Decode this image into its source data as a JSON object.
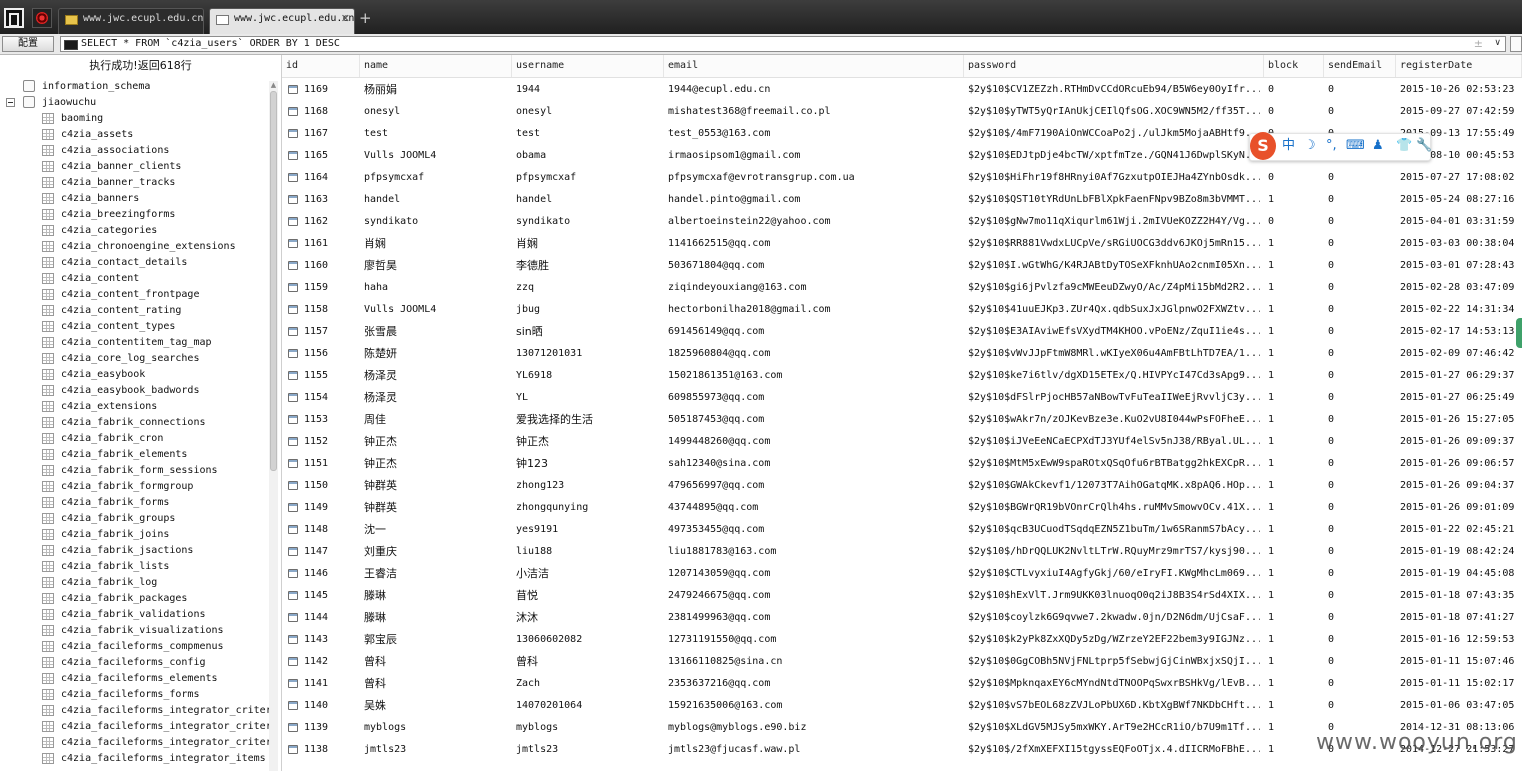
{
  "tabs": [
    {
      "label": "www.jwc.ecupl.edu.cn",
      "active": false
    },
    {
      "label": "www.jwc.ecupl.edu.cn",
      "active": true
    }
  ],
  "toolbar": {
    "config_label": "配置",
    "sql": "SELECT * FROM `c4zia_users` ORDER BY 1 DESC",
    "extra": "±",
    "dropdown": "∨"
  },
  "status": "执行成功!返回618行",
  "tree": {
    "databases": [
      {
        "name": "information_schema",
        "expanded": false
      },
      {
        "name": "jiaowuchu",
        "expanded": true
      }
    ],
    "tables": [
      "baoming",
      "c4zia_assets",
      "c4zia_associations",
      "c4zia_banner_clients",
      "c4zia_banner_tracks",
      "c4zia_banners",
      "c4zia_breezingforms",
      "c4zia_categories",
      "c4zia_chronoengine_extensions",
      "c4zia_contact_details",
      "c4zia_content",
      "c4zia_content_frontpage",
      "c4zia_content_rating",
      "c4zia_content_types",
      "c4zia_contentitem_tag_map",
      "c4zia_core_log_searches",
      "c4zia_easybook",
      "c4zia_easybook_badwords",
      "c4zia_extensions",
      "c4zia_fabrik_connections",
      "c4zia_fabrik_cron",
      "c4zia_fabrik_elements",
      "c4zia_fabrik_form_sessions",
      "c4zia_fabrik_formgroup",
      "c4zia_fabrik_forms",
      "c4zia_fabrik_groups",
      "c4zia_fabrik_joins",
      "c4zia_fabrik_jsactions",
      "c4zia_fabrik_lists",
      "c4zia_fabrik_log",
      "c4zia_fabrik_packages",
      "c4zia_fabrik_validations",
      "c4zia_fabrik_visualizations",
      "c4zia_facileforms_compmenus",
      "c4zia_facileforms_config",
      "c4zia_facileforms_elements",
      "c4zia_facileforms_forms",
      "c4zia_facileforms_integrator_criter",
      "c4zia_facileforms_integrator_criter",
      "c4zia_facileforms_integrator_criter",
      "c4zia_facileforms_integrator_items"
    ]
  },
  "grid": {
    "columns": [
      "id",
      "name",
      "username",
      "email",
      "password",
      "block",
      "sendEmail",
      "registerDate"
    ],
    "rows": [
      [
        "1169",
        "杨丽娟",
        "1944",
        "1944@ecupl.edu.cn",
        "$2y$10$CV1ZEZzh.RTHmDvCCdORcuEb94/B5W6ey0OyIfr...",
        "0",
        "0",
        "2015-10-26 02:53:23"
      ],
      [
        "1168",
        "onesyl",
        "onesyl",
        "mishatest368@freemail.co.pl",
        "$2y$10$yTWT5yQrIAnUkjCEIlQfsOG.XOC9WN5M2/ff35T...",
        "0",
        "0",
        "2015-09-27 07:42:59"
      ],
      [
        "1167",
        "test",
        "test",
        "test_0553@163.com",
        "$2y$10$/4mF7190AiOnWCCoaPo2j./ulJkm5MojaABHtf9...",
        "0",
        "0",
        "2015-09-13 17:55:49"
      ],
      [
        "1165",
        "Vulls JOOML4",
        "obama",
        "irmaosipsom1@gmail.com",
        "$2y$10$EDJtpDje4bcTW/xptfmTze./GQN41J6DwplSKyN...",
        "0",
        "0",
        "2015-08-10 00:45:53"
      ],
      [
        "1164",
        "pfpsymcxaf",
        "pfpsymcxaf",
        "pfpsymcxaf@evrotransgrup.com.ua",
        "$2y$10$HiFhr19f8HRnyi0Af7GzxutpOIEJHa4ZYnbOsdk...",
        "0",
        "0",
        "2015-07-27 17:08:02"
      ],
      [
        "1163",
        "handel",
        "handel",
        "handel.pinto@gmail.com",
        "$2y$10$QST10tYRdUnLbFBlXpkFaenFNpv9BZo8m3bVMMT...",
        "1",
        "0",
        "2015-05-24 08:27:16"
      ],
      [
        "1162",
        "syndikato",
        "syndikato",
        "albertoeinstein22@yahoo.com",
        "$2y$10$gNw7mo11qXiqurlm61Wji.2mIVUeKOZZ2H4Y/Vg...",
        "0",
        "0",
        "2015-04-01 03:31:59"
      ],
      [
        "1161",
        "肖娴",
        "肖娴",
        "1141662515@qq.com",
        "$2y$10$RR881VwdxLUCpVe/sRGiUOCG3ddv6JKOj5mRn15...",
        "1",
        "0",
        "2015-03-03 00:38:04"
      ],
      [
        "1160",
        "廖哲昊",
        "李德胜",
        "503671804@qq.com",
        "$2y$10$I.wGtWhG/K4RJABtDyTOSeXFknhUAo2cnmI05Xn...",
        "1",
        "0",
        "2015-03-01 07:28:43"
      ],
      [
        "1159",
        "haha",
        "zzq",
        "ziqindeyouxiang@163.com",
        "$2y$10$gi6jPvlzfa9cMWEeuDZwyO/Ac/Z4pMi15bMd2R2...",
        "1",
        "0",
        "2015-02-28 03:47:09"
      ],
      [
        "1158",
        "Vulls JOOML4",
        "jbug",
        "hectorbonilha2018@gmail.com",
        "$2y$10$41uuEJKp3.ZUr4Qx.qdbSuxJxJGlpnwO2FXWZtv...",
        "1",
        "0",
        "2015-02-22 14:31:34"
      ],
      [
        "1157",
        "张雪晨",
        "sin晒",
        "691456149@qq.com",
        "$2y$10$E3AIAviwEfsVXydTM4KHOO.vPoENz/ZquI1ie4s...",
        "1",
        "0",
        "2015-02-17 14:53:13"
      ],
      [
        "1156",
        "陈楚妍",
        "13071201031",
        "1825960804@qq.com",
        "$2y$10$vWvJJpFtmW8MRl.wKIyeX06u4AmFBtLhTD7EA/1...",
        "1",
        "0",
        "2015-02-09 07:46:42"
      ],
      [
        "1155",
        "杨泽灵",
        "YL6918",
        "15021861351@163.com",
        "$2y$10$ke7i6tlv/dgXD15ETEx/Q.HIVPYcI47Cd3sApg9...",
        "1",
        "0",
        "2015-01-27 06:29:37"
      ],
      [
        "1154",
        "杨泽灵",
        "YL",
        "609855973@qq.com",
        "$2y$10$dFSlrPjocHB57aNBowTvFuTeaIIWeEjRvvljC3y...",
        "1",
        "0",
        "2015-01-27 06:25:49"
      ],
      [
        "1153",
        "周佳",
        "爱我选择的生活",
        "505187453@qq.com",
        "$2y$10$wAkr7n/zOJKevBze3e.KuO2vU8I044wPsFOFheE...",
        "1",
        "0",
        "2015-01-26 15:27:05"
      ],
      [
        "1152",
        "钟正杰",
        "钟正杰",
        "1499448260@qq.com",
        "$2y$10$iJVeEeNCaECPXdTJ3YUf4elSv5nJ38/RByal.UL...",
        "1",
        "0",
        "2015-01-26 09:09:37"
      ],
      [
        "1151",
        "钟正杰",
        "钟123",
        "sah12340@sina.com",
        "$2y$10$MtM5xEwW9spaROtxQSqOfu6rBTBatgg2hkEXCpR...",
        "1",
        "0",
        "2015-01-26 09:06:57"
      ],
      [
        "1150",
        "钟群英",
        "zhong123",
        "479656997@qq.com",
        "$2y$10$GWAkCkevf1/12073T7AihOGatqMK.x8pAQ6.HOp...",
        "1",
        "0",
        "2015-01-26 09:04:37"
      ],
      [
        "1149",
        "钟群英",
        "zhongqunying",
        "43744895@qq.com",
        "$2y$10$BGWrQR19bVOnrCrQlh4hs.ruMMvSmowvOCv.41X...",
        "1",
        "0",
        "2015-01-26 09:01:09"
      ],
      [
        "1148",
        "沈一",
        "yes9191",
        "497353455@qq.com",
        "$2y$10$qcB3UCuodTSqdqEZN5Z1buTm/1w6SRanmS7bAcy...",
        "1",
        "0",
        "2015-01-22 02:45:21"
      ],
      [
        "1147",
        "刘重庆",
        "liu188",
        "liu1881783@163.com",
        "$2y$10$/hDrQQLUK2NvltLTrW.RQuyMrz9mrTS7/kysj90...",
        "1",
        "0",
        "2015-01-19 08:42:24"
      ],
      [
        "1146",
        "王睿洁",
        "小洁洁",
        "1207143059@qq.com",
        "$2y$10$CTLvyxiuI4AgfyGkj/60/eIryFI.KWgMhcLm069...",
        "1",
        "0",
        "2015-01-19 04:45:08"
      ],
      [
        "1145",
        "滕琳",
        "苜悦",
        "2479246675@qq.com",
        "$2y$10$hExVlT.Jrm9UKK03lnuoqO0q2iJ8B3S4rSd4XIX...",
        "1",
        "0",
        "2015-01-18 07:43:35"
      ],
      [
        "1144",
        "滕琳",
        "沐沐",
        "2381499963@qq.com",
        "$2y$10$coylzk6G9qvwe7.2kwadw.0jn/D2N6dm/UjCsaF...",
        "1",
        "0",
        "2015-01-18 07:41:27"
      ],
      [
        "1143",
        "郭宝辰",
        "13060602082",
        "12731191550@qq.com",
        "$2y$10$k2yPk8ZxXQDy5zDg/WZrzeY2EF22bem3y9IGJNz...",
        "1",
        "0",
        "2015-01-16 12:59:53"
      ],
      [
        "1142",
        "曾科",
        "曾科",
        "13166110825@sina.cn",
        "$2y$10$0GgCOBh5NVjFNLtprp5fSebwjGjCinWBxjxSQjI...",
        "1",
        "0",
        "2015-01-11 15:07:46"
      ],
      [
        "1141",
        "曾科",
        "Zach",
        "2353637216@qq.com",
        "$2y$10$MpknqaxEY6cMYndNtdTNOOPqSwxrBSHkVg/lEvB...",
        "1",
        "0",
        "2015-01-11 15:02:17"
      ],
      [
        "1140",
        "吴姝",
        "14070201064",
        "15921635006@163.com",
        "$2y$10$vS7bEOL68zZVJLoPbUX6D.KbtXgBWf7NKDbCHft...",
        "1",
        "0",
        "2015-01-06 03:47:05"
      ],
      [
        "1139",
        "myblogs",
        "myblogs",
        "myblogs@myblogs.e90.biz",
        "$2y$10$XLdGV5MJSy5mxWKY.ArT9e2HCcR1iO/b7U9m1Tf...",
        "1",
        "0",
        "2014-12-31 08:13:06"
      ],
      [
        "1138",
        "jmtls23",
        "jmtls23",
        "jmtls23@fjucasf.waw.pl",
        "$2y$10$/2fXmXEFXI15tgyssEQFoOTjx.4.dIICRMoFBhE...",
        "1",
        "0",
        "2014-12-27 21:53:27"
      ]
    ]
  },
  "ime": {
    "logo": "S",
    "items": [
      "中",
      "☽",
      "°,",
      "⌨",
      "♟",
      "👕",
      "🔧"
    ]
  },
  "watermark": "www.wooyun.org"
}
